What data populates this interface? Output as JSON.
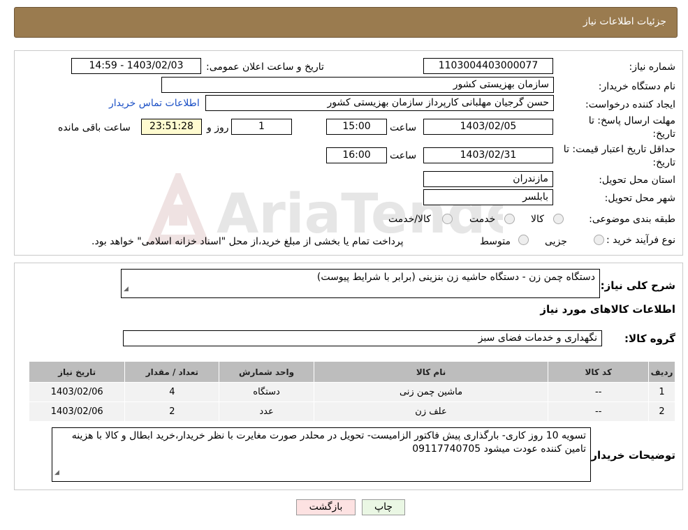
{
  "header": {
    "title": "جزئیات اطلاعات نیاز"
  },
  "form": {
    "need_number": {
      "label": "شماره نیاز:",
      "value": "1103004403000077"
    },
    "announce": {
      "label": "تاریخ و ساعت اعلان عمومی:",
      "value": "1403/02/03 - 14:59"
    },
    "buyer_org": {
      "label": "نام دستگاه خریدار:",
      "value": "سازمان بهزیستی کشور"
    },
    "requester": {
      "label": "ایجاد کننده درخواست:",
      "value": "حسن گرجیان مهلبانی کارپرداز سازمان بهزیستی کشور",
      "contact_link": "اطلاعات تماس خریدار"
    },
    "deadline": {
      "label_line1": "مهلت ارسال پاسخ: تا",
      "label_line2": "تاریخ:",
      "date": "1403/02/05",
      "time_label": "ساعت",
      "time": "15:00",
      "days": "1",
      "days_label": "روز و",
      "remaining": "23:51:28",
      "remaining_label": "ساعت باقی مانده"
    },
    "validity": {
      "label_line1": "حداقل تاریخ اعتبار قیمت: تا",
      "label_line2": "تاریخ:",
      "date": "1403/02/31",
      "time_label": "ساعت",
      "time": "16:00"
    },
    "province": {
      "label": "استان محل تحویل:",
      "value": "مازندران"
    },
    "city": {
      "label": "شهر محل تحویل:",
      "value": "بابلسر"
    },
    "category": {
      "label": "طبقه بندی موضوعی:",
      "options": [
        "کالا",
        "خدمت",
        "کالا/خدمت"
      ]
    },
    "process": {
      "label": "نوع فرآیند خرید :",
      "options": [
        "جزیی",
        "متوسط"
      ],
      "note": "پرداخت تمام یا بخشی از مبلغ خرید،از محل \"اسناد خزانه اسلامی\" خواهد بود."
    }
  },
  "description": {
    "label": "شرح کلی نیاز:",
    "value": "دستگاه چمن زن - دستگاه حاشیه زن بنزینی (برابر با شرایط پیوست)"
  },
  "goods_section_title": "اطلاعات کالاهای مورد نیاز",
  "goods_group": {
    "label": "گروه کالا:",
    "value": "نگهداری و خدمات فضای سبز"
  },
  "table": {
    "headers": [
      "ردیف",
      "کد کالا",
      "نام کالا",
      "واحد شمارش",
      "تعداد / مقدار",
      "تاریخ نیاز"
    ],
    "rows": [
      [
        "1",
        "--",
        "ماشین چمن زنی",
        "دستگاه",
        "4",
        "1403/02/06"
      ],
      [
        "2",
        "--",
        "علف زن",
        "عدد",
        "2",
        "1403/02/06"
      ]
    ]
  },
  "buyer_notes": {
    "label": "توضیحات خریدار:",
    "value": "تسویه 10 روز کاری- بارگذاری پیش فاکتور الزامیست- تحویل در محلدر صورت مغایرت با نظر خریدار،خرید ابطال و کالا با هزینه تامین کننده عودت میشود 09117740705"
  },
  "buttons": {
    "print": "چاپ",
    "back": "بازگشت"
  },
  "watermark": {
    "text": "AriaTender.neT"
  },
  "colors": {
    "header_bg": "#9a7b4f",
    "print_btn": "#eaf7e4",
    "back_btn": "#fde2e2",
    "link": "#1a4fc5"
  }
}
